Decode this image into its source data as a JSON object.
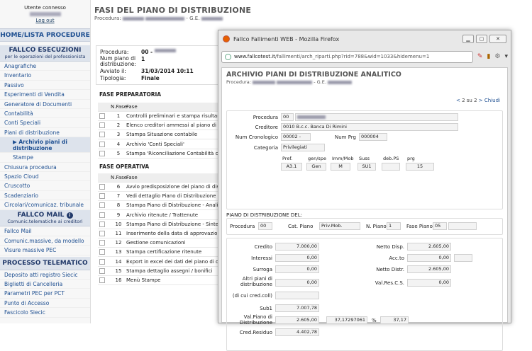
{
  "sidebar": {
    "user_label": "Utente connesso",
    "logout": "Log out",
    "home": "HOME/LISTA PROCEDURE",
    "sec1": {
      "title": "FALLCO ESECUZIONI",
      "sub": "per le operazioni del professionista"
    },
    "items1": [
      "Anagrafiche",
      "Inventario",
      "Passivo",
      "Esperimenti di Vendita",
      "Generatore di Documenti",
      "Contabilità",
      "Conti Speciali",
      "Piani di distribuzione"
    ],
    "active": "▶ Archivio piani di distribuzione",
    "stampe": "Stampe",
    "items2": [
      "Chiusura procedura",
      "Spazio Cloud",
      "Cruscotto",
      "Scadenziario",
      "Circolari/comunicaz. tribunale"
    ],
    "sec2": {
      "title": "FALLCO MAIL",
      "sub": "Comunic.telematiche ai creditori"
    },
    "items3": [
      "Fallco Mail",
      "Comunic.massive, da modello",
      "Visure massive PEC"
    ],
    "sec3": {
      "title": "PROCESSO TELEMATICO"
    },
    "items4": [
      "Deposito atti registro Siecic",
      "Biglietti di Cancelleria",
      "Parametri PEC per PCT",
      "Punto di Accesso",
      "Fascicolo Siecic"
    ]
  },
  "main": {
    "title": "FASI DEL PIANO DI DISTRIBUZIONE",
    "sub_prefix": "Procedura:",
    "sub_suffix": "- G.E.",
    "info": [
      {
        "k": "Procedura:",
        "v": "00 -"
      },
      {
        "k": "Num piano di distribuzione:",
        "v": "1"
      },
      {
        "k": "Avviato il:",
        "v": "31/03/2014 10:11"
      },
      {
        "k": "Tipologia:",
        "v": "Finale"
      }
    ],
    "prep_title": "FASE PREPARATORIA",
    "op_title": "FASE OPERATIVA",
    "col_n": "N.Fase",
    "col_f": "Fase",
    "prep": [
      {
        "n": "1",
        "t": "Controlli preliminari e stampa risultanze"
      },
      {
        "n": "2",
        "t": "Elenco creditori ammessi al piano di distribuzione"
      },
      {
        "n": "3",
        "t": "Stampa Situazione contabile"
      },
      {
        "n": "4",
        "t": "Archivio 'Conti Speciali'"
      },
      {
        "n": "5",
        "t": "Stampa 'Riconciliazione Contabilità conti speciali'"
      }
    ],
    "op": [
      {
        "n": "6",
        "t": "Avvio predisposizione del piano di distribuzione"
      },
      {
        "n": "7",
        "t": "Vedi dettaglio Piano di Distribuzione"
      },
      {
        "n": "8",
        "t": "Stampa Piano di Distribuzione - Analitico"
      },
      {
        "n": "9",
        "t": "Archivio ritenute / Trattenute"
      },
      {
        "n": "10",
        "t": "Stampa Piano di Distribuzione - Sintetico"
      },
      {
        "n": "11",
        "t": "Inserimento della data di approvazione"
      },
      {
        "n": "12",
        "t": "Gestione comunicazioni"
      },
      {
        "n": "13",
        "t": "Stampa certificazione ritenute"
      },
      {
        "n": "14",
        "t": "Export in excel dei dati del piano di distribuzione"
      },
      {
        "n": "15",
        "t": "Stampa dettaglio assegni / bonifici"
      },
      {
        "n": "16",
        "t": "Menù Stampe"
      }
    ]
  },
  "popup": {
    "window_title": "Fallco Fallimenti WEB - Mozilla Firefox",
    "url_domain": "www.fallcotest.it",
    "url_rest": "/fallimenti/arch_riparti.php?rid=788&wid=1033&hidemenu=1",
    "title": "ARCHIVIO PIANI DI DISTRIBUZIONE ANALITICO",
    "sub_prefix": "Procedura:",
    "sub_suffix": "- G.E.",
    "pager_text": "2 su 2",
    "pager_close": "Chiudi",
    "procedura_label": "Procedura",
    "procedura_code": "00",
    "creditore_label": "Creditore",
    "creditore_value": "0010 B.c.c. Banca Di Rimini",
    "numcron_label": "Num Cronologico",
    "numcron_value": "00002 -",
    "numprg_label": "Num Prg",
    "numprg_value": "000004",
    "categoria_label": "Categoria",
    "categoria_value": "Privilegiati",
    "caps": [
      "Pref.",
      "gen/spe",
      "Imm/Mob",
      "Suss",
      "deb.PS",
      "prg"
    ],
    "capvals": [
      "A3.1",
      "Gen",
      "M",
      "SU1",
      "",
      "15"
    ],
    "fs_label": "PIANO DI DISTRIBUZIONE DEL:",
    "fs": {
      "proc_label": "Procedura",
      "proc_value": "00",
      "cat_label": "Cat. Piano",
      "cat_value": "Priv.Mob.",
      "np_label": "N. Piano",
      "np_value": "1",
      "fp_label": "Fase Piano",
      "fp_value": "05"
    },
    "credito_label": "Credito",
    "credito_value": "7.000,00",
    "nettodisp_label": "Netto Disp.",
    "nettodisp_value": "2.605,00",
    "interessi_label": "Interessi",
    "interessi_value": "0,00",
    "accto_label": "Acc.to",
    "accto_value": "0,00",
    "surroga_label": "Surroga",
    "surroga_value": "0,00",
    "nettodistr_label": "Netto Distr.",
    "nettodistr_value": "2.605,00",
    "altri_label": "Altri piani di distribuzione",
    "altri_value": "0,00",
    "valres_label": "Val.Res.C.S.",
    "valres_value": "0,00",
    "dicui_label": "(di cui cred.coll)",
    "dicui_value": "",
    "sub1_label": "Sub1",
    "sub1_value": "7.007,78",
    "valpiano_label": "Val.Piano di Distribuzione",
    "valpiano_value": "2.605,00",
    "valpiano_pct": "37,17297061",
    "pct_sign": "%",
    "valpiano_pct2": "37,17",
    "credres_label": "Cred.Residuo",
    "credres_value": "4.402,78"
  }
}
